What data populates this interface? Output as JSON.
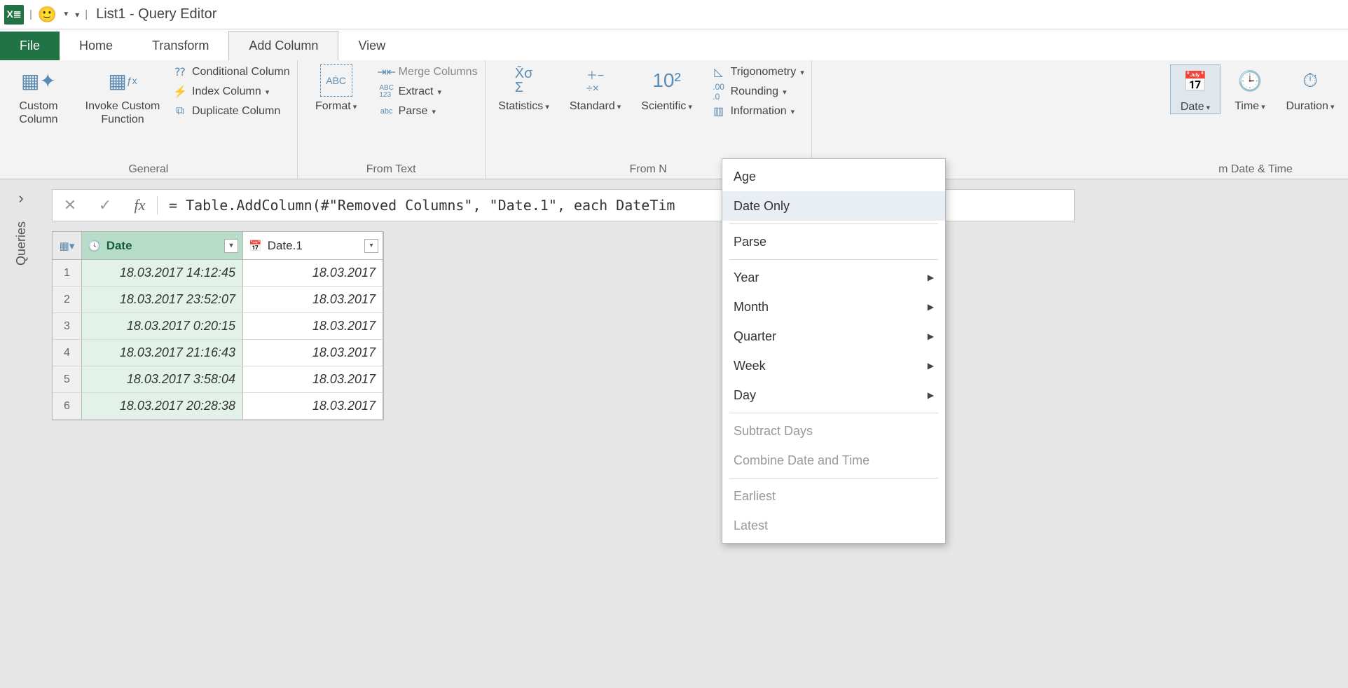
{
  "title": {
    "app_name": "List1 - Query Editor"
  },
  "tabs": {
    "file": "File",
    "home": "Home",
    "transform": "Transform",
    "add_column": "Add Column",
    "view": "View"
  },
  "ribbon": {
    "general": {
      "label": "General",
      "custom_column": "Custom\nColumn",
      "invoke_custom": "Invoke Custom\nFunction",
      "conditional": "Conditional Column",
      "index": "Index Column",
      "duplicate": "Duplicate Column"
    },
    "from_text": {
      "label": "From Text",
      "format": "Format",
      "merge": "Merge Columns",
      "extract": "Extract",
      "parse": "Parse"
    },
    "from_number": {
      "label": "From N",
      "statistics": "Statistics",
      "standard": "Standard",
      "scientific": "Scientific",
      "trig": "Trigonometry",
      "rounding": "Rounding",
      "information": "Information"
    },
    "datetime": {
      "label": "m Date & Time",
      "date": "Date",
      "time": "Time",
      "duration": "Duration"
    }
  },
  "date_menu": {
    "age": "Age",
    "date_only": "Date Only",
    "parse": "Parse",
    "year": "Year",
    "month": "Month",
    "quarter": "Quarter",
    "week": "Week",
    "day": "Day",
    "subtract": "Subtract Days",
    "combine": "Combine Date and Time",
    "earliest": "Earliest",
    "latest": "Latest"
  },
  "sidebar": {
    "label": "Queries"
  },
  "formula": {
    "text": "= Table.AddColumn(#\"Removed Columns\", \"Date.1\", each DateTim"
  },
  "grid": {
    "columns": [
      {
        "name": "Date"
      },
      {
        "name": "Date.1"
      }
    ],
    "rows": [
      {
        "n": "1",
        "date": "18.03.2017 14:12:45",
        "date1": "18.03.2017"
      },
      {
        "n": "2",
        "date": "18.03.2017 23:52:07",
        "date1": "18.03.2017"
      },
      {
        "n": "3",
        "date": "18.03.2017 0:20:15",
        "date1": "18.03.2017"
      },
      {
        "n": "4",
        "date": "18.03.2017 21:16:43",
        "date1": "18.03.2017"
      },
      {
        "n": "5",
        "date": "18.03.2017 3:58:04",
        "date1": "18.03.2017"
      },
      {
        "n": "6",
        "date": "18.03.2017 20:28:38",
        "date1": "18.03.2017"
      }
    ]
  }
}
